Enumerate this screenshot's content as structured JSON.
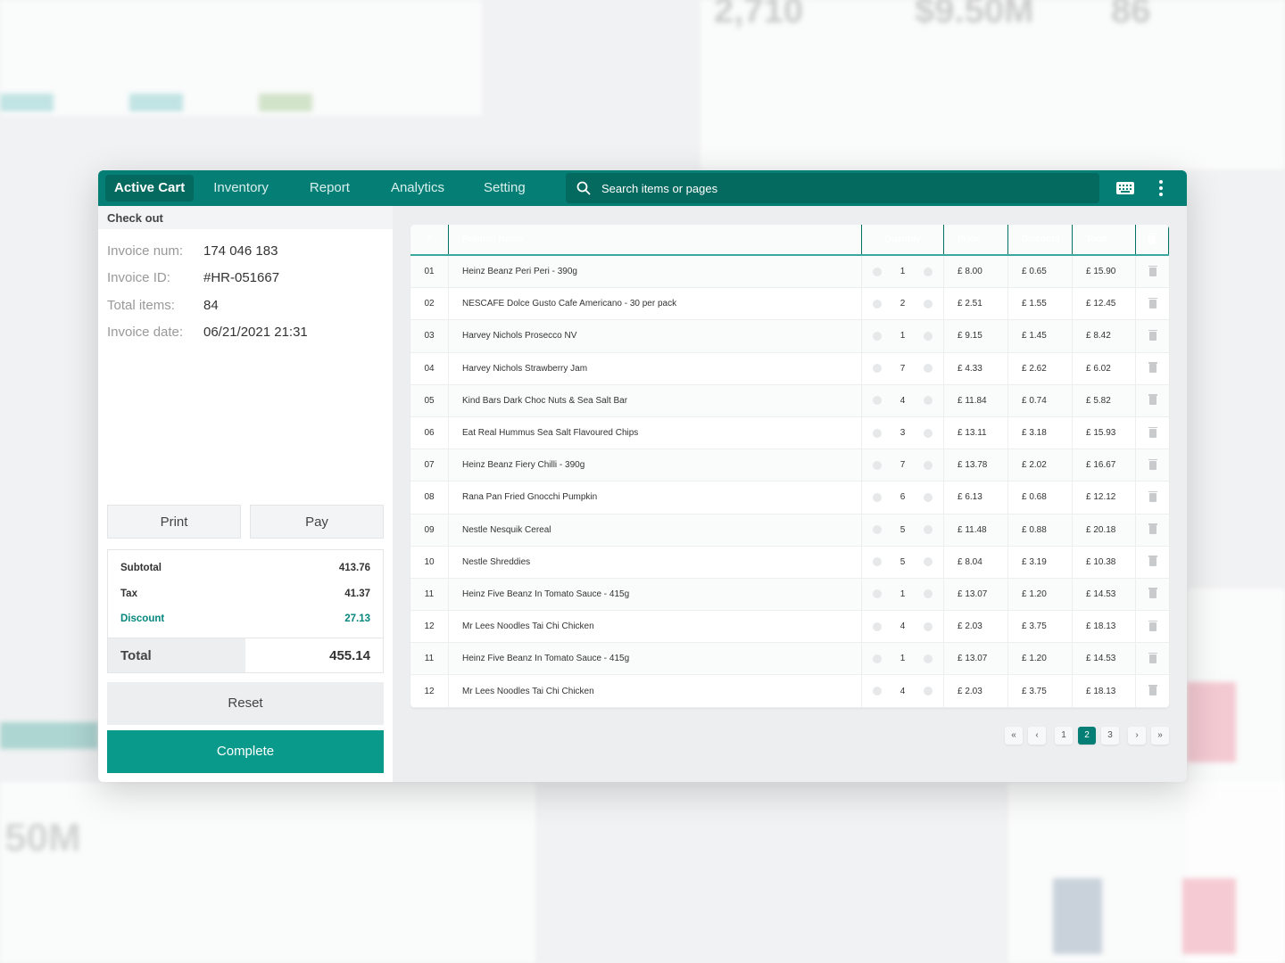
{
  "nav": {
    "tabs": [
      "Active Cart",
      "Inventory",
      "Report",
      "Analytics",
      "Setting"
    ],
    "active": 0,
    "search_placeholder": "Search items or pages"
  },
  "checkout": {
    "title": "Check out",
    "info": [
      {
        "k": "Invoice num:",
        "v": "174 046 183"
      },
      {
        "k": "Invoice ID:",
        "v": "#HR-051667"
      },
      {
        "k": "Total items:",
        "v": "84"
      },
      {
        "k": "Invoice date:",
        "v": "06/21/2021 21:31"
      }
    ],
    "print": "Print",
    "pay": "Pay",
    "subtotal_label": "Subtotal",
    "subtotal": "413.76",
    "tax_label": "Tax",
    "tax": "41.37",
    "discount_label": "Discount",
    "discount": "27.13",
    "total_label": "Total",
    "total": "455.14",
    "reset": "Reset",
    "complete": "Complete"
  },
  "table": {
    "headers": [
      "#",
      "Product Name",
      "Quantity",
      "Price",
      "Discount",
      "Total"
    ],
    "rows": [
      [
        "01",
        "Heinz Beanz Peri Peri - 390g",
        "1",
        "£ 8.00",
        "£ 0.65",
        "£ 15.90"
      ],
      [
        "02",
        "NESCAFE Dolce Gusto Cafe Americano - 30 per pack",
        "2",
        "£ 2.51",
        "£ 1.55",
        "£ 12.45"
      ],
      [
        "03",
        "Harvey Nichols Prosecco NV",
        "1",
        "£ 9.15",
        "£ 1.45",
        "£ 8.42"
      ],
      [
        "04",
        "Harvey Nichols Strawberry Jam",
        "7",
        "£ 4.33",
        "£ 2.62",
        "£ 6.02"
      ],
      [
        "05",
        "Kind Bars Dark Choc Nuts & Sea Salt Bar",
        "4",
        "£ 11.84",
        "£ 0.74",
        "£ 5.82"
      ],
      [
        "06",
        "Eat Real Hummus Sea Salt Flavoured Chips",
        "3",
        "£ 13.11",
        "£ 3.18",
        "£ 15.93"
      ],
      [
        "07",
        "Heinz Beanz Fiery Chilli - 390g",
        "7",
        "£ 13.78",
        "£ 2.02",
        "£ 16.67"
      ],
      [
        "08",
        "Rana Pan Fried Gnocchi Pumpkin",
        "6",
        "£ 6.13",
        "£ 0.68",
        "£ 12.12"
      ],
      [
        "09",
        "Nestle Nesquik Cereal",
        "5",
        "£ 11.48",
        "£ 0.88",
        "£ 20.18"
      ],
      [
        "10",
        "Nestle Shreddies",
        "5",
        "£ 8.04",
        "£ 3.19",
        "£ 10.38"
      ],
      [
        "11",
        "Heinz Five Beanz In Tomato Sauce - 415g",
        "1",
        "£ 13.07",
        "£ 1.20",
        "£ 14.53"
      ],
      [
        "12",
        "Mr Lees Noodles Tai Chi Chicken",
        "4",
        "£ 2.03",
        "£ 3.75",
        "£ 18.13"
      ],
      [
        "11",
        "Heinz Five Beanz In Tomato Sauce - 415g",
        "1",
        "£ 13.07",
        "£ 1.20",
        "£ 14.53"
      ],
      [
        "12",
        "Mr Lees Noodles Tai Chi Chicken",
        "4",
        "£ 2.03",
        "£ 3.75",
        "£ 18.13"
      ]
    ]
  },
  "pagination": {
    "first": "«",
    "prev": "‹",
    "pages": [
      "1",
      "2",
      "3"
    ],
    "current": "2",
    "next": "›",
    "last": "»"
  },
  "background": {
    "stats": [
      "2,710",
      "$9.50M",
      "86"
    ],
    "blurred_stat": "50M"
  },
  "colors": {
    "brand": "#057f76",
    "complete": "#0a9a8c"
  }
}
